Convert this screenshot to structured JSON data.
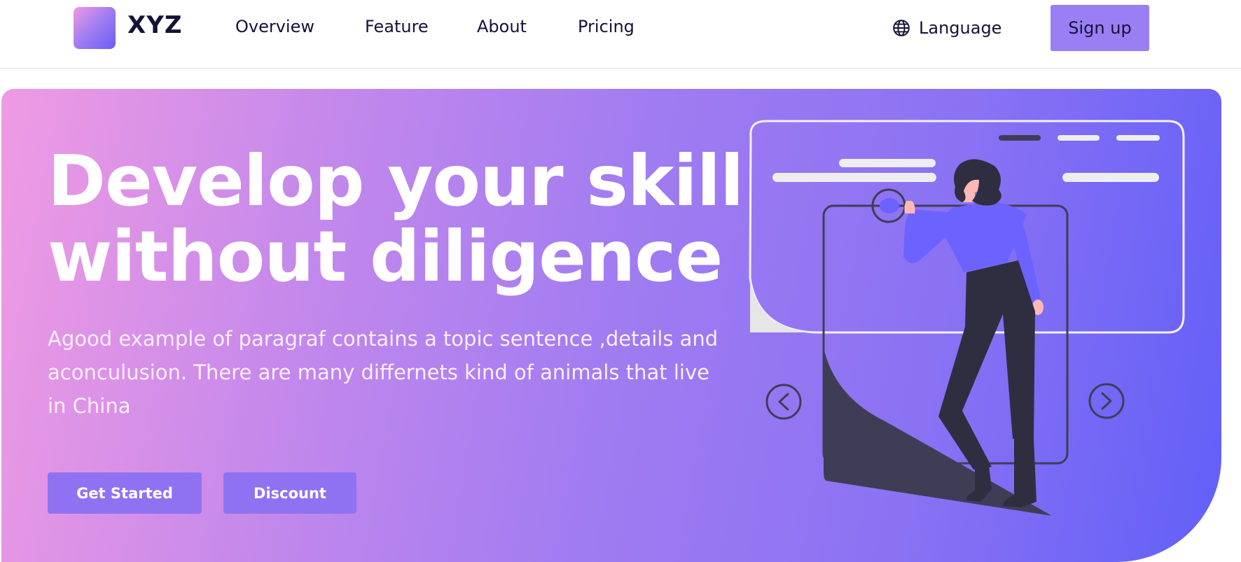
{
  "brand": {
    "logo_text": "XYZ",
    "logo_gradient": [
      "#ee9be2",
      "#9f7cf1",
      "#6b5cf6"
    ]
  },
  "nav": {
    "items": [
      {
        "label": "Overview"
      },
      {
        "label": "Feature"
      },
      {
        "label": "About"
      },
      {
        "label": "Pricing"
      }
    ],
    "language_label": "Language",
    "language_icon": "globe-icon",
    "signup_label": "Sign up"
  },
  "hero": {
    "title_line1": "Develop your skill",
    "title_line2": "without diligence",
    "paragraph": "Agood example of paragraf contains a topic sentence ,details and aconculusion. There are many differnets kind of animals that live in China",
    "primary_button": "Get Started",
    "secondary_button": "Discount",
    "gradient": [
      "#ef9be3",
      "#a17cf1",
      "#625ff8"
    ],
    "carousel_prev_icon": "chevron-left-icon",
    "carousel_next_icon": "chevron-right-icon"
  },
  "colors": {
    "text_dark": "#141238",
    "accent": "#9a7ef3",
    "button": "#8f72f1",
    "figure_dark": "#2f2e41",
    "figure_top": "#6c63ff"
  }
}
